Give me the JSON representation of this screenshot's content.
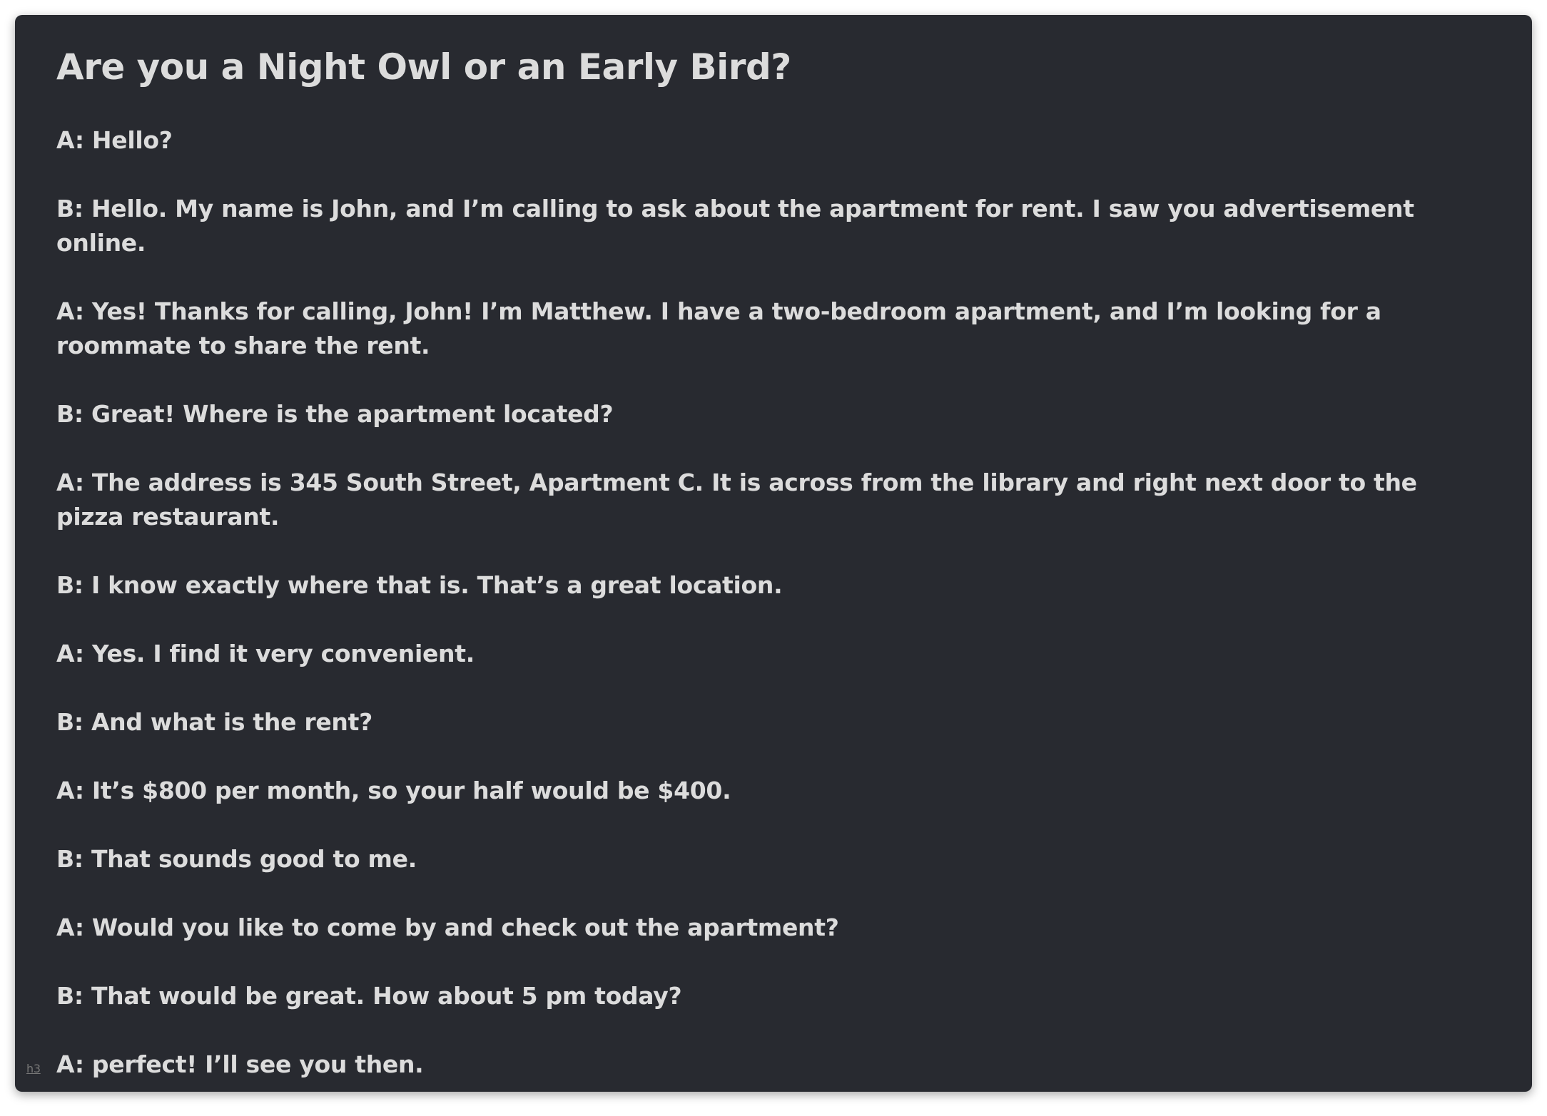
{
  "title": "Are you a Night Owl or an Early Bird?",
  "heading_marker": "h3",
  "lines": [
    "A: Hello?",
    "B: Hello. My name is John, and I’m calling to ask about the apartment for rent. I saw you advertisement online.",
    "A: Yes! Thanks for calling, John! I’m Matthew. I have a two-bedroom apartment, and I’m looking for a roommate to share the rent.",
    "B: Great! Where is the apartment located?",
    "A: The address is 345 South Street, Apartment C. It is across from the library and right next door to the pizza restaurant.",
    "B: I know exactly where that is. That’s a great location.",
    "A: Yes. I find it very convenient.",
    "B: And what is the rent?",
    "A: It’s $800 per month, so your half would be $400.",
    "B: That sounds good to me.",
    "A: Would you like to come by and check out the apartment?",
    "B: That would be great.  How about 5 pm today?",
    "A: perfect! I’ll see you then."
  ]
}
